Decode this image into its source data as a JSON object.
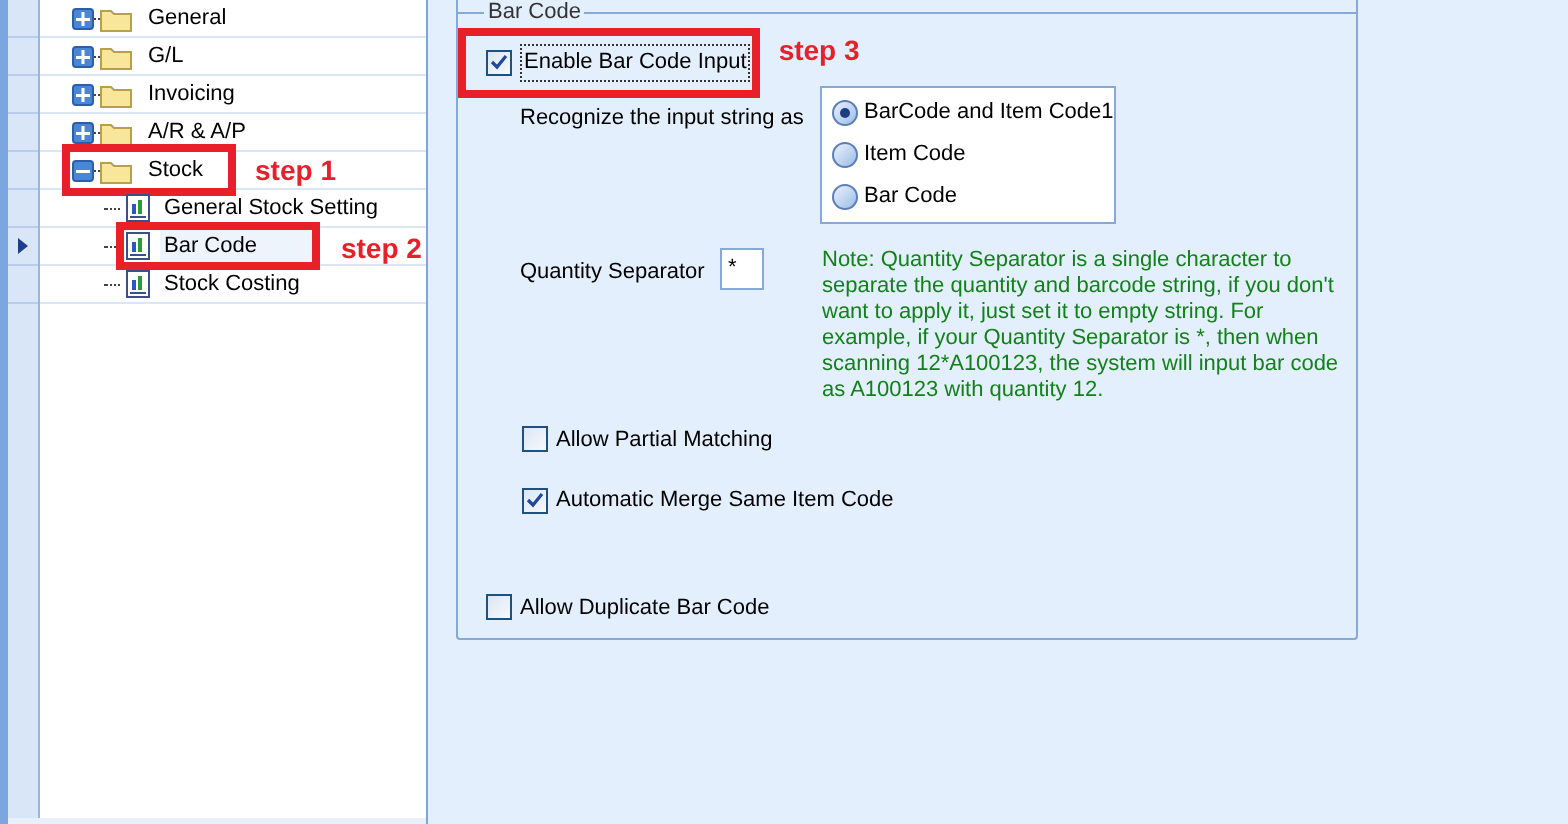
{
  "tree": [
    {
      "label": "General",
      "expanded": false
    },
    {
      "label": "G/L",
      "expanded": false
    },
    {
      "label": "Invoicing",
      "expanded": false
    },
    {
      "label": "A/R & A/P",
      "expanded": false
    },
    {
      "label": "Stock",
      "expanded": true,
      "annotation": "step 1",
      "children": [
        {
          "label": "General Stock Setting",
          "selected": false
        },
        {
          "label": "Bar Code",
          "selected": true,
          "annotation": "step 2"
        },
        {
          "label": "Stock Costing",
          "selected": false
        }
      ]
    }
  ],
  "group": {
    "title": "Bar Code",
    "enable": {
      "label": "Enable Bar Code Input",
      "checked": true,
      "annotation": "step 3"
    },
    "recognize_label": "Recognize the input string as",
    "recognize_options": [
      {
        "label": "BarCode and Item Code1",
        "selected": true
      },
      {
        "label": "Item Code",
        "selected": false
      },
      {
        "label": "Bar Code",
        "selected": false
      }
    ],
    "separator": {
      "label": "Quantity Separator",
      "value": "*"
    },
    "note": "Note: Quantity Separator is a single character to separate the quantity and barcode string, if you don't want to apply it, just set it to empty string. For example, if your Quantity Separator is *, then when scanning 12*A100123, the system will input bar code as A100123 with quantity 12.",
    "options": [
      {
        "label": "Allow Partial Matching",
        "checked": false
      },
      {
        "label": "Automatic Merge Same Item Code",
        "checked": true
      }
    ],
    "duplicate": {
      "label": "Allow Duplicate Bar Code",
      "checked": false
    }
  }
}
